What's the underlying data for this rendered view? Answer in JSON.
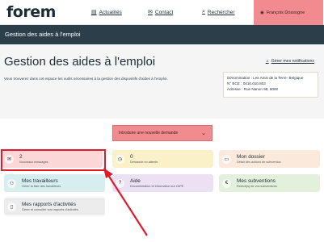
{
  "header": {
    "logo_text": "forem",
    "nav": [
      {
        "label": "Actualités",
        "icon": "newspaper-icon"
      },
      {
        "label": "Contact",
        "icon": "envelope-icon"
      },
      {
        "label": "Rechercher",
        "icon": "search-icon"
      }
    ],
    "user_name": "François Dossogne"
  },
  "band_title": "Gestion des aides à l'emploi",
  "page": {
    "title": "Gestion des aides à l'emploi",
    "notifications_link": "Gérer mes notifications",
    "intro": "Vous trouverez dans cet espace les outils nécessaires à la gestion des dispositifs d'aides à l'emploi.",
    "info": {
      "line1": "Dénomination : Les Amis de la Terre- Belgique",
      "line2": "N° BCE : 0416.010.803",
      "line3": "Adresse : Rue Nanon 98, 5000"
    }
  },
  "intro_button_label": "Introduire une nouvelle demande",
  "cards": [
    {
      "name": "card-messages",
      "title": "2",
      "subtitle": "Nouveaux messages",
      "icon": "mail-icon"
    },
    {
      "name": "card-demandes",
      "title": "0",
      "subtitle": "Demande en attente",
      "icon": "clock-icon"
    },
    {
      "name": "card-dossier",
      "title": "Mon dossier",
      "subtitle": "Détail des actions de subvention",
      "icon": "folder-icon"
    },
    {
      "name": "card-travailleurs",
      "title": "Mes travailleurs",
      "subtitle": "Gérer la liste des travailleurs",
      "icon": "people-icon"
    },
    {
      "name": "card-aide",
      "title": "Aide",
      "subtitle": "Documentation et information sur l'APE",
      "icon": "help-icon"
    },
    {
      "name": "card-subventions",
      "title": "Mes subventions",
      "subtitle": "Relevé(s) de vos subventions",
      "icon": "coins-icon"
    },
    {
      "name": "card-rapports",
      "title": "Mes rapports d'activités",
      "subtitle": "Gérer et consulter vos rapports d'activités",
      "icon": "document-icon"
    }
  ],
  "colors": {
    "header_band": "#2c3e4a",
    "accent_pink": "#f28b8f",
    "highlight_red": "#e01b2b",
    "card_pink": "#fbd7d8",
    "card_yellow": "#fbf1c8",
    "card_orange": "#fbeadb",
    "card_teal": "#d6efee",
    "card_purple": "#ece1f3",
    "card_green": "#e3f1dc",
    "card_gray": "#ececec"
  }
}
